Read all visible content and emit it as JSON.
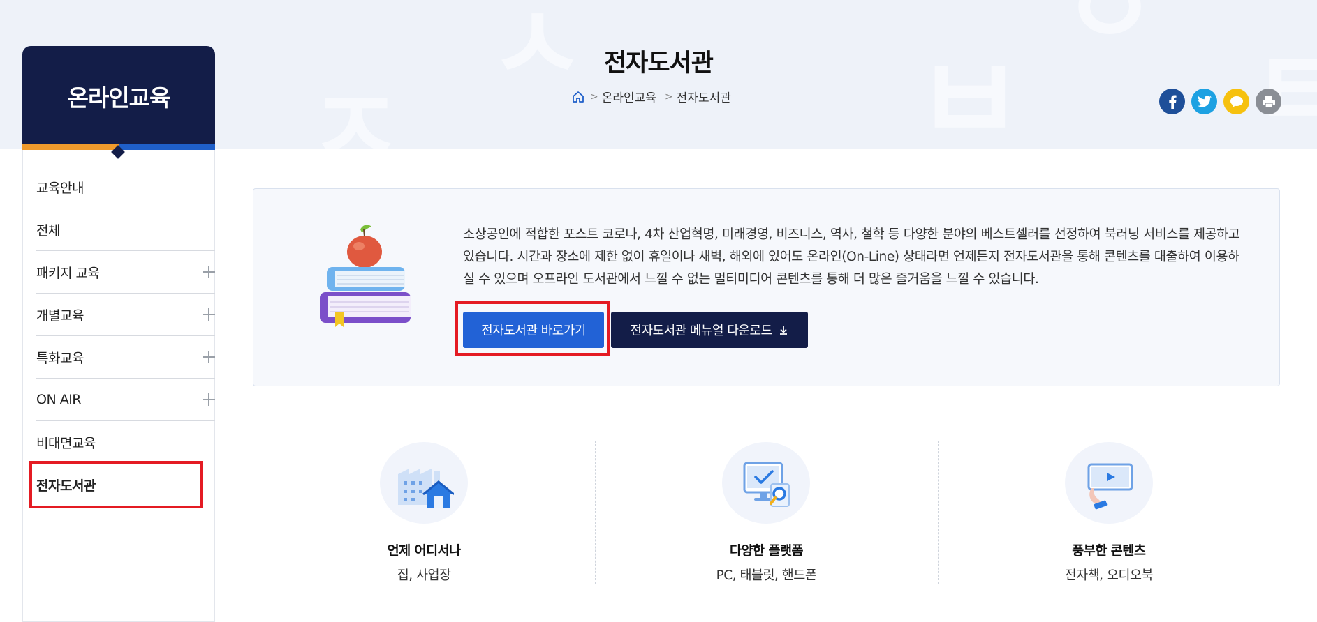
{
  "sidebar": {
    "title": "온라인교육",
    "items": [
      {
        "label": "교육안내",
        "expandable": false
      },
      {
        "label": "전체",
        "expandable": false
      },
      {
        "label": "패키지 교육",
        "expandable": true
      },
      {
        "label": "개별교육",
        "expandable": true
      },
      {
        "label": "특화교육",
        "expandable": true
      },
      {
        "label": "ON AIR",
        "expandable": true
      },
      {
        "label": "비대면교육",
        "expandable": false
      },
      {
        "label": "전자도서관",
        "expandable": false,
        "active": true
      }
    ]
  },
  "header": {
    "title": "전자도서관",
    "breadcrumb": [
      "온라인교육",
      "전자도서관"
    ]
  },
  "share": {
    "icons": [
      "facebook-icon",
      "twitter-icon",
      "kakaotalk-icon",
      "print-icon"
    ]
  },
  "info": {
    "description": "소상공인에 적합한 포스트 코로나, 4차 산업혁명, 미래경영, 비즈니스, 역사, 철학 등 다양한 분야의 베스트셀러를 선정하여 북러닝 서비스를 제공하고 있습니다. 시간과 장소에 제한 없이 휴일이나 새벽, 해외에 있어도 온라인(On-Line) 상태라면 언제든지 전자도서관을 통해 콘텐츠를 대출하여 이용하실 수 있으며 오프라인 도서관에서 느낄 수 없는 멀티미디어 콘텐츠를 통해 더 많은 즐거움을 느낄 수 있습니다.",
    "go_button": "전자도서관 바로가기",
    "download_button": "전자도서관 메뉴얼 다운로드"
  },
  "features": [
    {
      "title": "언제 어디서나",
      "subtitle": "집, 사업장",
      "icon": "factory-house-icon"
    },
    {
      "title": "다양한 플랫폼",
      "subtitle": "PC, 태블릿, 핸드폰",
      "icon": "monitor-search-icon"
    },
    {
      "title": "풍부한 콘텐츠",
      "subtitle": "전자책, 오디오북",
      "icon": "video-player-icon"
    }
  ],
  "colors": {
    "navy": "#131d48",
    "blue": "#2262d6",
    "orange_accent": "#ef9a2c",
    "highlight_red": "#e41b23",
    "band_bg": "#eef2f9"
  }
}
